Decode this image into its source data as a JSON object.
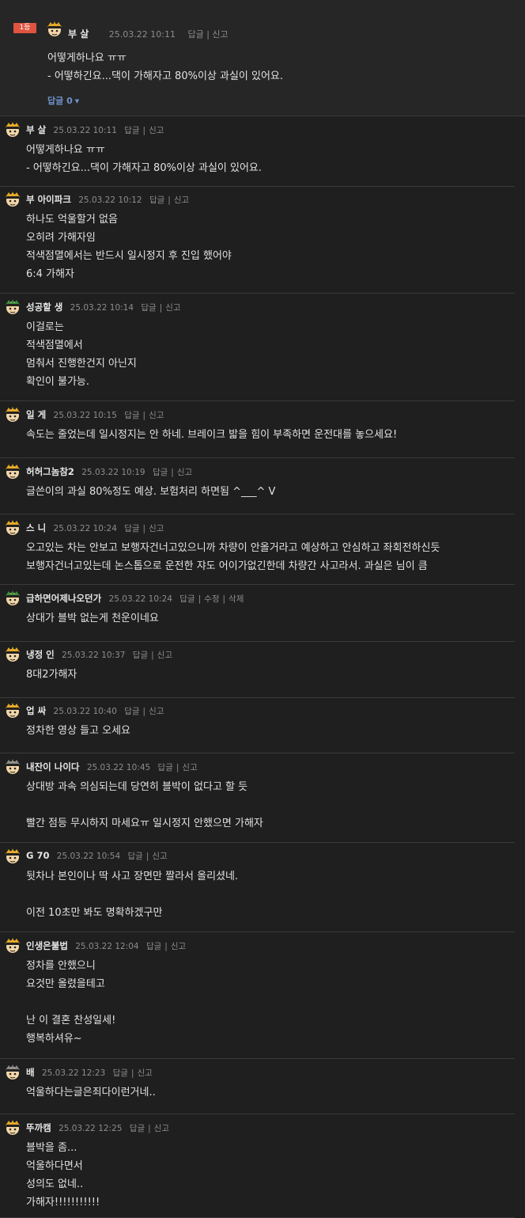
{
  "best_comment": {
    "rank_badge": "1등",
    "nickname": "부 살",
    "time": "25.03.22 10:11",
    "reply_label": "답글",
    "report_label": "신고",
    "body": "어떻게하나요 ㅠㅠ\n- 어떻하긴요...댁이 가해자고 80%이상 과실이 있어요.",
    "reply_count_label": "답글 0"
  },
  "comments": [
    {
      "nickname": "부 살",
      "time": "25.03.22 10:11",
      "actions": [
        "답글",
        "신고"
      ],
      "body": "어떻게하나요 ㅠㅠ\n- 어떻하긴요...댁이 가해자고 80%이상 과실이 있어요."
    },
    {
      "nickname": "부 아이파크",
      "time": "25.03.22 10:12",
      "actions": [
        "답글",
        "신고"
      ],
      "body": "하나도 억울할거 없음\n오히려 가해자임\n적색점멸에서는 반드시 일시정지 후 진입 했어야\n6:4 가해자"
    },
    {
      "nickname": "성공할 생",
      "time": "25.03.22 10:14",
      "actions": [
        "답글",
        "신고"
      ],
      "body": "이걸로는\n적색점멸에서\n멈춰서 진행한건지 아닌지\n확인이 불가능."
    },
    {
      "nickname": "일 게",
      "time": "25.03.22 10:15",
      "actions": [
        "답글",
        "신고"
      ],
      "body": "속도는 줄었는데 일시정지는 안 하네. 브레이크 밟을 힘이 부족하면 운전대를 놓으세요!"
    },
    {
      "nickname": "허허그놈참2",
      "time": "25.03.22 10:19",
      "actions": [
        "답글",
        "신고"
      ],
      "body": "글쓴이의 과실 80%정도 예상. 보험처리 하면됨 ^___^ V"
    },
    {
      "nickname": "스 니",
      "time": "25.03.22 10:24",
      "actions": [
        "답글",
        "신고"
      ],
      "body": "오고있는 차는 안보고 보행자건너고있으니까 차량이 안올거라고 예상하고 안심하고 좌회전하신듯\n보행자건너고있는데 논스톱으로 운전한 쟈도 어이가없긴한데 차량간 사고라서. 과실은 님이 큼"
    },
    {
      "nickname": "급하면어제나오던가",
      "time": "25.03.22 10:24",
      "actions": [
        "답글",
        "수정",
        "삭제"
      ],
      "body": "상대가 블박 없는게 천운이네요"
    },
    {
      "nickname": "냉정 인",
      "time": "25.03.22 10:37",
      "actions": [
        "답글",
        "신고"
      ],
      "body": "8대2가해자"
    },
    {
      "nickname": "업 싸",
      "time": "25.03.22 10:40",
      "actions": [
        "답글",
        "신고"
      ],
      "body": "정차한 영상 들고 오세요"
    },
    {
      "nickname": "내잔이 나이다",
      "time": "25.03.22 10:45",
      "actions": [
        "답글",
        "신고"
      ],
      "body": "상대방 과속 의심되는데 당연히 블박이 없다고 할 듯\n\n빨간 점등 무시하지 마세요ㅠ 일시정지 안했으면 가해자"
    },
    {
      "nickname": "G 70",
      "time": "25.03.22 10:54",
      "actions": [
        "답글",
        "신고"
      ],
      "body": "뒷차나 본인이나 딱 사고 장면만 짤라서 올리셨네.\n\n이전 10초만 봐도 명확하겠구만"
    },
    {
      "nickname": "인생은불법",
      "time": "25.03.22 12:04",
      "actions": [
        "답글",
        "신고"
      ],
      "body": "정차를 안했으니\n요것만 올렸을테고\n\n난 이 결혼 찬성일세!\n행복하셔유~"
    },
    {
      "nickname": "배",
      "time": "25.03.22 12:23",
      "actions": [
        "답글",
        "신고"
      ],
      "body": "억울하다는글은죄다이런거네.."
    },
    {
      "nickname": "뚜까캠",
      "time": "25.03.22 12:25",
      "actions": [
        "답글",
        "신고"
      ],
      "body": "블박을 좀...\n억울하다면서\n성의도 없네..\n가해자!!!!!!!!!!!"
    }
  ]
}
